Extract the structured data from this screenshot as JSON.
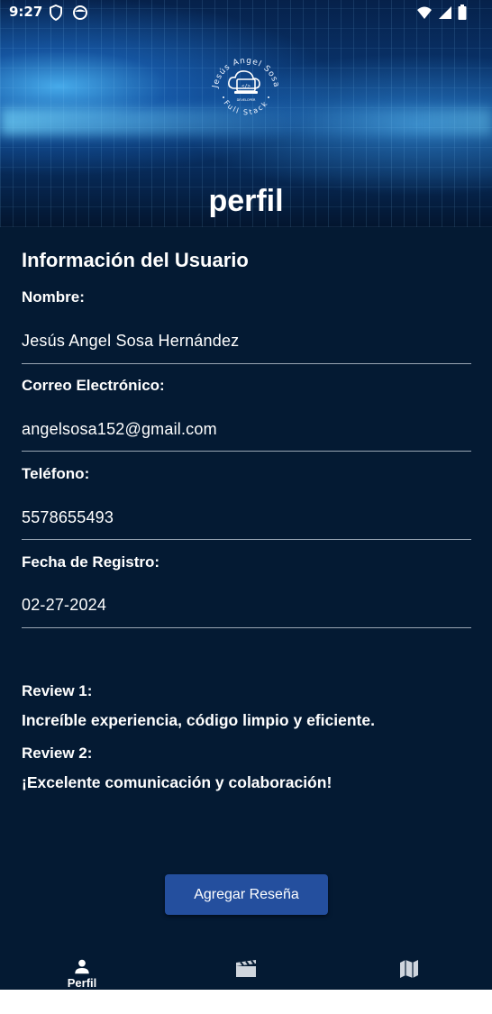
{
  "status_bar": {
    "time": "9:27"
  },
  "header": {
    "title": "perfil",
    "logo_text_top": "Jesús Angel Sosa",
    "logo_text_bottom": "Full Stack",
    "logo_small": "DEVELOPER"
  },
  "profile": {
    "section_title": "Información del Usuario",
    "fields": [
      {
        "label": "Nombre:",
        "value": "Jesús Angel Sosa Hernández"
      },
      {
        "label": "Correo Electrónico:",
        "value": "angelsosa152@gmail.com"
      },
      {
        "label": "Teléfono:",
        "value": "5578655493"
      },
      {
        "label": "Fecha de Registro:",
        "value": "02-27-2024"
      }
    ]
  },
  "reviews": [
    {
      "label": "Review 1:",
      "text": "Increíble experiencia, código limpio y eficiente."
    },
    {
      "label": "Review 2:",
      "text": "¡Excelente comunicación y colaboración!"
    }
  ],
  "actions": {
    "add_review_label": "Agregar Reseña"
  },
  "bottom_nav": {
    "items": [
      {
        "label": "Perfil",
        "icon": "person-icon",
        "active": true
      },
      {
        "label": "",
        "icon": "movie-clapper-icon",
        "active": false
      },
      {
        "label": "",
        "icon": "map-icon",
        "active": false
      }
    ]
  }
}
